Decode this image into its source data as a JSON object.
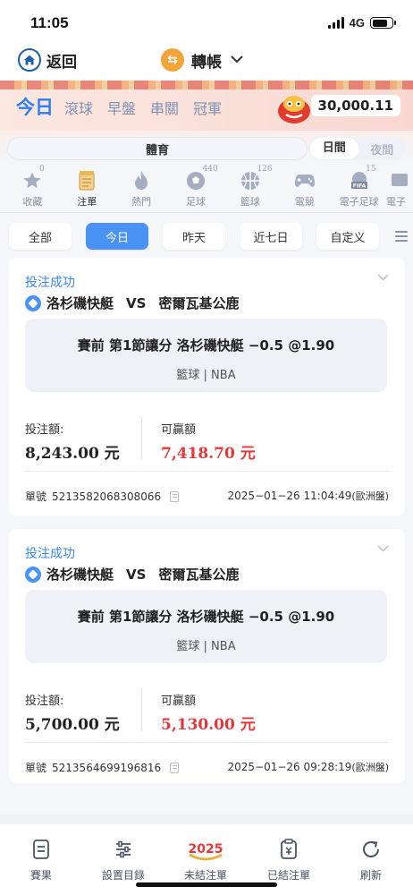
{
  "status_bar": {
    "time": "11:05",
    "network": "4G",
    "battery_pct": 0.8
  },
  "nav": {
    "back_label": "返回",
    "title": "轉帳",
    "title_icon": "transfer-coin-icon"
  },
  "banner": {
    "tabs": [
      {
        "label": "今日",
        "active": true
      },
      {
        "label": "滾球"
      },
      {
        "label": "早盤"
      },
      {
        "label": "串關"
      },
      {
        "label": "冠軍"
      }
    ],
    "balance": "30,000.11"
  },
  "segment": {
    "sport_label": "體育",
    "day_label": "日間",
    "night_label": "夜間"
  },
  "categories": [
    {
      "label": "收藏",
      "count": "0",
      "icon": "star-icon"
    },
    {
      "label": "注單",
      "count": "",
      "icon": "notebook-icon",
      "active": true
    },
    {
      "label": "熱門",
      "count": "",
      "icon": "fire-icon"
    },
    {
      "label": "足球",
      "count": "440",
      "icon": "soccer-icon"
    },
    {
      "label": "籃球",
      "count": "126",
      "icon": "basketball-icon"
    },
    {
      "label": "電競",
      "count": "",
      "icon": "gamepad-icon"
    },
    {
      "label": "電子足球",
      "count": "15",
      "icon": "fifa-icon"
    },
    {
      "label": "電子",
      "count": "",
      "icon": "esport-icon"
    }
  ],
  "filters": [
    {
      "label": "全部"
    },
    {
      "label": "今日",
      "active": true
    },
    {
      "label": "昨天"
    },
    {
      "label": "近七日"
    },
    {
      "label": "自定义"
    }
  ],
  "bets": [
    {
      "status": "投注成功",
      "home": "洛杉磯快艇",
      "vs": "VS",
      "away": "密爾瓦基公鹿",
      "selection": "賽前 第1節讓分 洛杉磯快艇 −0.5 @1.90",
      "league": "籃球 | NBA",
      "stake_label": "投注額:",
      "stake": "8,243.00 元",
      "win_label": "可贏額",
      "win": "7,418.70 元",
      "order_label": "單號",
      "order_no": "5213582068308066",
      "datetime": "2025−01−26 11:04:49",
      "odds_type": "(歐洲盤)"
    },
    {
      "status": "投注成功",
      "home": "洛杉磯快艇",
      "vs": "VS",
      "away": "密爾瓦基公鹿",
      "selection": "賽前 第1節讓分 洛杉磯快艇 −0.5 @1.90",
      "league": "籃球 | NBA",
      "stake_label": "投注額:",
      "stake": "5,700.00 元",
      "win_label": "可贏額",
      "win": "5,130.00 元",
      "order_label": "單號",
      "order_no": "5213564699196816",
      "datetime": "2025−01−26 09:28:19",
      "odds_type": "(歐洲盤)"
    }
  ],
  "tabbar": [
    {
      "label": "賽果",
      "icon": "results-doc-icon"
    },
    {
      "label": "設置目錄",
      "icon": "sliders-icon"
    },
    {
      "label": "未結注單",
      "icon": "2025-badge-icon",
      "active": true
    },
    {
      "label": "已結注單",
      "icon": "clipboard-icon"
    },
    {
      "label": "刷新",
      "icon": "refresh-icon"
    }
  ],
  "colors": {
    "accent": "#4a93f5",
    "win": "#e2383a",
    "status": "#3a87ee"
  }
}
